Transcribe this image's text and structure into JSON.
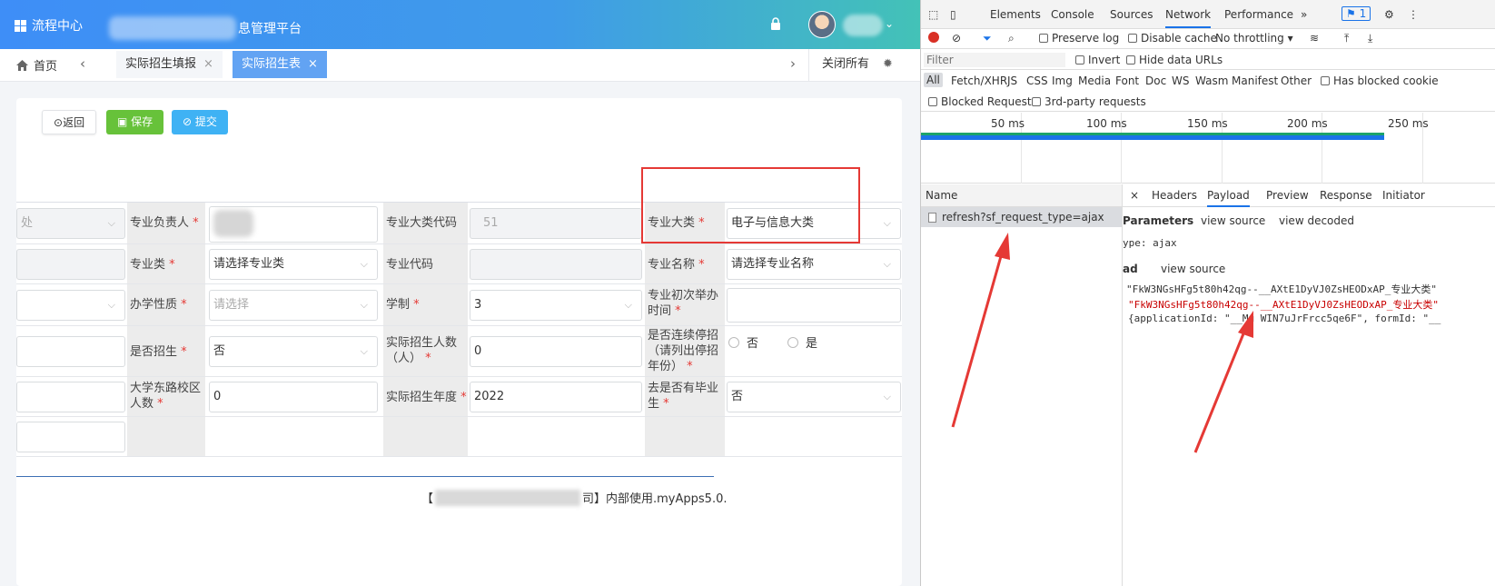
{
  "app": {
    "brand_label": "流程中心",
    "platform_title_suffix": "息管理平台",
    "tabs": {
      "home_label": "首页",
      "tab1_label": "实际招生填报",
      "tab2_label": "实际招生表",
      "close_all_label": "关闭所有"
    },
    "buttons": {
      "back_label": "返回",
      "save_label": "保存",
      "submit_label": "提交"
    },
    "form": {
      "rows": [
        {
          "f0": "处",
          "l1": "专业负责人",
          "r1": true,
          "v1": "",
          "l2": "专业大类代码",
          "v2": "51",
          "l3": "专业大类",
          "r3": true,
          "v3": "电子与信息大类"
        },
        {
          "l1": "专业类",
          "r1": true,
          "v1": "请选择专业类",
          "l2": "专业代码",
          "v2": "",
          "l3": "专业名称",
          "r3": true,
          "v3": "请选择专业名称"
        },
        {
          "l1": "办学性质",
          "r1": true,
          "v1": "请选择",
          "l2": "学制",
          "r2": true,
          "v2": "3",
          "l3": "专业初次举办时间",
          "r3": true,
          "v3": ""
        },
        {
          "l1": "是否招生",
          "r1": true,
          "v1": "否",
          "l2": "实际招生人数（人）",
          "r2": true,
          "v2": "0",
          "l3": "是否连续停招（请列出停招年份）",
          "r3": true,
          "radio_no": "否",
          "radio_yes": "是"
        },
        {
          "l1": "大学东路校区人数",
          "r1": true,
          "v1": "0",
          "l2": "实际招生年度",
          "r2": true,
          "v2": "2022",
          "l3": "去是否有毕业生",
          "r3": true,
          "v3": "否"
        }
      ]
    },
    "footer": {
      "prefix": "【",
      "suffix": "司】内部使用.myApps5.0."
    }
  },
  "devtools": {
    "tabs": [
      "Elements",
      "Console",
      "Sources",
      "Network",
      "Performance",
      "»"
    ],
    "badge": "1",
    "toolbar": {
      "preserve_log": "Preserve log",
      "disable_cache": "Disable cache",
      "throttling": "No throttling"
    },
    "filter": {
      "placeholder": "Filter",
      "invert": "Invert",
      "hide_data_urls": "Hide data URLs"
    },
    "types": [
      "All",
      "Fetch/XHR",
      "JS",
      "CSS",
      "Img",
      "Media",
      "Font",
      "Doc",
      "WS",
      "Wasm",
      "Manifest",
      "Other"
    ],
    "has_blocked_cookies": "Has blocked cookie",
    "blocked_requests": "Blocked Requests",
    "third_party": "3rd-party requests",
    "timeline_ticks": [
      "50 ms",
      "100 ms",
      "150 ms",
      "200 ms",
      "250 ms"
    ],
    "list": {
      "header": "Name",
      "request": "refresh?sf_request_type=ajax"
    },
    "detail": {
      "close": "×",
      "tabs": [
        "Headers",
        "Payload",
        "Preview",
        "Response",
        "Initiator"
      ],
      "parameters_heading": "Parameters",
      "view_source": "view source",
      "view_decoded": "view decoded",
      "type_line": "ype: ajax",
      "payload_heading": "ad",
      "payload_view_source": "view source",
      "line1": "\"FkW3NGsHFg5t80h42qg--__AXtE1DyVJ0ZsHEODxAP_专业大类\"",
      "line2": "\"FkW3NGsHFg5t80h42qg--__AXtE1DyVJ0ZsHEODxAP_专业大类\"",
      "line3": "{applicationId: \"__Mu WIN7uJrFrcc5qe6F\", formId: \"__"
    }
  },
  "colors": {
    "topbar_start": "#3e8ef7",
    "topbar_end": "#43c2b7",
    "active_tab": "#62a3f3",
    "save_green": "#67c23a",
    "submit_blue": "#3fb2f4",
    "annotation_red": "#e53935"
  }
}
